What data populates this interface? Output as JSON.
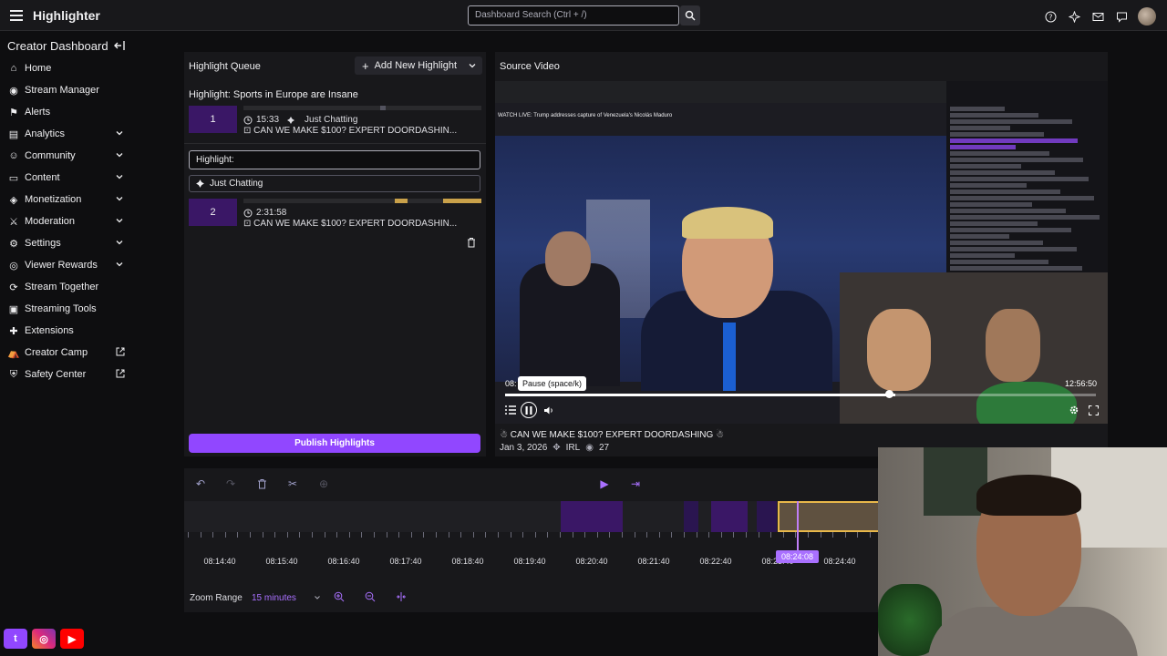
{
  "app": {
    "title": "Highlighter"
  },
  "search": {
    "placeholder": "Dashboard Search (Ctrl + /)"
  },
  "sidebar": {
    "header": "Creator Dashboard",
    "items": [
      {
        "label": "Home",
        "icon": "home-icon"
      },
      {
        "label": "Stream Manager",
        "icon": "stream-manager-icon"
      },
      {
        "label": "Alerts",
        "icon": "alerts-icon"
      },
      {
        "label": "Analytics",
        "icon": "analytics-icon",
        "expandable": true
      },
      {
        "label": "Community",
        "icon": "community-icon",
        "expandable": true
      },
      {
        "label": "Content",
        "icon": "content-icon",
        "expandable": true
      },
      {
        "label": "Monetization",
        "icon": "monetization-icon",
        "expandable": true
      },
      {
        "label": "Moderation",
        "icon": "moderation-icon",
        "expandable": true
      },
      {
        "label": "Settings",
        "icon": "settings-icon",
        "expandable": true
      },
      {
        "label": "Viewer Rewards",
        "icon": "viewer-rewards-icon",
        "expandable": true
      },
      {
        "label": "Stream Together",
        "icon": "stream-together-icon"
      },
      {
        "label": "Streaming Tools",
        "icon": "streaming-tools-icon"
      },
      {
        "label": "Extensions",
        "icon": "extensions-icon"
      },
      {
        "label": "Creator Camp",
        "icon": "creator-camp-icon",
        "external": true
      },
      {
        "label": "Safety Center",
        "icon": "safety-center-icon",
        "external": true
      }
    ]
  },
  "queue": {
    "title": "Highlight Queue",
    "add_label": "Add New Highlight",
    "highlight1_title": "Highlight: Sports in Europe are Insane",
    "clip1": {
      "index": "1",
      "duration": "15:33",
      "category": "Just Chatting",
      "title": "CAN WE MAKE $100? EXPERT DOORDASHIN..."
    },
    "highlight_input": "Highlight:",
    "category_input": "Just Chatting",
    "clip2": {
      "index": "2",
      "duration": "2:31:58",
      "title": "CAN WE MAKE $100? EXPERT DOORDASHIN..."
    },
    "publish_label": "Publish Highlights"
  },
  "source": {
    "title": "Source Video",
    "news_headline": "WATCH LIVE: Trump addresses capture of Venezuela's Nicolás Maduro",
    "time_left": "08:",
    "time_right": "12:56:50",
    "tooltip": "Pause (space/k)",
    "progress": 0.66,
    "video_title": "CAN WE MAKE $100? EXPERT DOORDASHING",
    "date": "Jan 3, 2026",
    "category": "IRL",
    "views": "27"
  },
  "timeline": {
    "ticks": [
      "08:14:40",
      "08:15:40",
      "08:16:40",
      "08:17:40",
      "08:18:40",
      "08:19:40",
      "08:20:40",
      "08:21:40",
      "08:22:40",
      "08:23:40",
      "08:24:40"
    ],
    "playhead": "08:24:08"
  },
  "zoom": {
    "label": "Zoom Range",
    "value": "15 minutes"
  },
  "colors": {
    "accent": "#9147ff",
    "purple_dark": "#3a1766",
    "gold": "#e8b84a"
  }
}
